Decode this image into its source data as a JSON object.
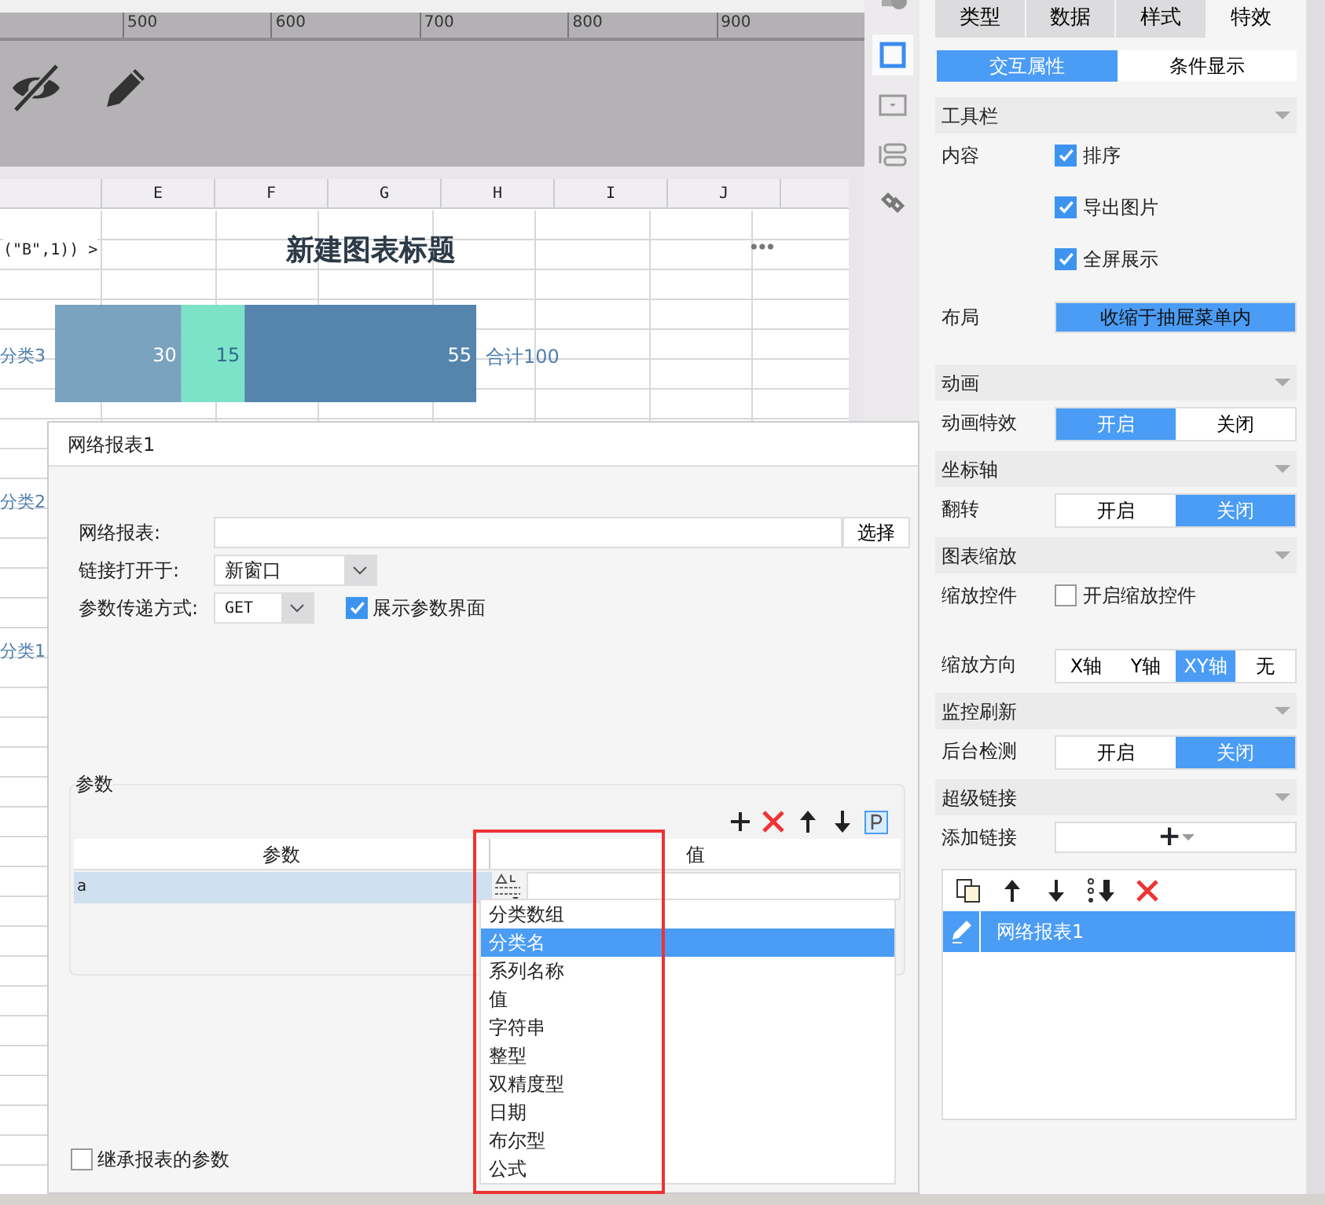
{
  "ruler": {
    "ticks": [
      "500",
      "600",
      "700",
      "800",
      "900"
    ]
  },
  "sheet": {
    "columns": [
      "",
      "E",
      "F",
      "G",
      "H",
      "I",
      "J"
    ],
    "formula_text": "(\"B\",1)) >",
    "side_labels": [
      "分类2",
      "分类1"
    ],
    "chart_data": {
      "type": "bar",
      "orientation": "horizontal",
      "stacked": true,
      "title": "新建图表标题",
      "categories": [
        "分类3"
      ],
      "data_labels": true,
      "series": [
        {
          "color": "#79a3bf",
          "values": [
            30
          ]
        },
        {
          "color": "#7de3c8",
          "values": [
            15
          ]
        },
        {
          "color": "#5585ad",
          "values": [
            55
          ]
        }
      ]
    },
    "total_label": "合计100"
  },
  "side_icons": [
    {
      "kind": "info",
      "selected": false
    },
    {
      "kind": "frame",
      "selected": true
    },
    {
      "kind": "dropdown",
      "selected": false
    },
    {
      "kind": "layers",
      "selected": false
    },
    {
      "kind": "link",
      "selected": false
    }
  ],
  "panel": {
    "tabs": [
      {
        "label": "类型",
        "selected": false
      },
      {
        "label": "数据",
        "selected": false
      },
      {
        "label": "样式",
        "selected": false
      },
      {
        "label": "特效",
        "selected": true
      }
    ],
    "subtabs": [
      {
        "label": "交互属性",
        "selected": true
      },
      {
        "label": "条件显示",
        "selected": false
      }
    ],
    "sections": [
      {
        "title": "工具栏",
        "rows": [
          {
            "kind": "checks",
            "label": "内容",
            "items": [
              {
                "label": "排序",
                "checked": true
              },
              {
                "label": "导出图片",
                "checked": true
              },
              {
                "label": "全屏展示",
                "checked": true
              }
            ]
          },
          {
            "kind": "button",
            "label": "布局",
            "value": "收缩于抽屉菜单内"
          }
        ]
      },
      {
        "title": "动画",
        "rows": [
          {
            "kind": "toggle",
            "label": "动画特效",
            "options": [
              {
                "label": "开启",
                "selected": true
              },
              {
                "label": "关闭",
                "selected": false
              }
            ]
          }
        ]
      },
      {
        "title": "坐标轴",
        "rows": [
          {
            "kind": "toggle",
            "label": "翻转",
            "options": [
              {
                "label": "开启",
                "selected": false
              },
              {
                "label": "关闭",
                "selected": true
              }
            ]
          }
        ]
      },
      {
        "title": "图表缩放",
        "rows": [
          {
            "kind": "checks",
            "label": "缩放控件",
            "items": [
              {
                "label": "开启缩放控件",
                "checked": false
              }
            ]
          },
          {
            "kind": "toggle",
            "label": "缩放方向",
            "options": [
              {
                "label": "X轴",
                "selected": false
              },
              {
                "label": "Y轴",
                "selected": false
              },
              {
                "label": "XY轴",
                "selected": true
              },
              {
                "label": "无",
                "selected": false
              }
            ]
          }
        ]
      },
      {
        "title": "监控刷新",
        "rows": [
          {
            "kind": "toggle",
            "label": "后台检测",
            "options": [
              {
                "label": "开启",
                "selected": false
              },
              {
                "label": "关闭",
                "selected": true
              }
            ]
          }
        ]
      },
      {
        "title": "超级链接",
        "rows": [
          {
            "kind": "add",
            "label": "添加链接",
            "value": "+"
          }
        ]
      }
    ],
    "links": [
      {
        "label": "网络报表1",
        "selected": true
      }
    ]
  },
  "dialog": {
    "title": "网络报表1",
    "report_label": "网络报表:",
    "choose_button": "选择",
    "open_label": "链接打开于:",
    "open_value": "新窗口",
    "method_label": "参数传递方式:",
    "method_value": "GET",
    "show_params": {
      "label": "展示参数界面",
      "checked": true
    },
    "params_title": "参数",
    "columns": [
      "参数",
      "值"
    ],
    "rows": [
      {
        "name": "a",
        "value": ""
      }
    ],
    "type_options": [
      {
        "label": "分类数组",
        "selected": false
      },
      {
        "label": "分类名",
        "selected": true
      },
      {
        "label": "系列名称",
        "selected": false
      },
      {
        "label": "值",
        "selected": false
      },
      {
        "label": "字符串",
        "selected": false
      },
      {
        "label": "整型",
        "selected": false
      },
      {
        "label": "双精度型",
        "selected": false
      },
      {
        "label": "日期",
        "selected": false
      },
      {
        "label": "布尔型",
        "selected": false
      },
      {
        "label": "公式",
        "selected": false
      }
    ],
    "inherit": {
      "label": "继承报表的参数",
      "checked": false
    }
  }
}
